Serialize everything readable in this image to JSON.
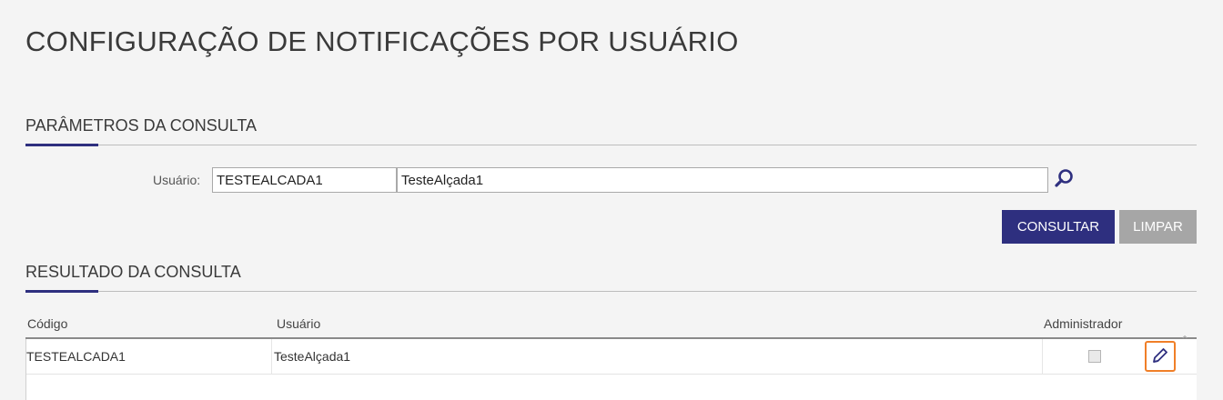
{
  "page": {
    "title": "CONFIGURAÇÃO DE NOTIFICAÇÕES POR USUÁRIO"
  },
  "params_section": {
    "title": "PARÂMETROS DA CONSULTA",
    "user_label": "Usuário:",
    "user_code_value": "TESTEALCADA1",
    "user_name_value": "TesteAlçada1",
    "search_icon": "magnifier-icon"
  },
  "actions": {
    "consultar_label": "CONSULTAR",
    "limpar_label": "LIMPAR"
  },
  "results_section": {
    "title": "RESULTADO DA CONSULTA",
    "columns": [
      "Código",
      "Usuário",
      "Administrador"
    ],
    "rows": [
      {
        "codigo": "TESTEALCADA1",
        "usuario": "TesteAlçada1",
        "administrador": false
      }
    ],
    "edit_icon": "pencil-icon"
  },
  "colors": {
    "primary": "#2e2f7f",
    "disabled": "#a6a6a6",
    "highlight": "#f07f28",
    "background": "#f4f4f4"
  }
}
